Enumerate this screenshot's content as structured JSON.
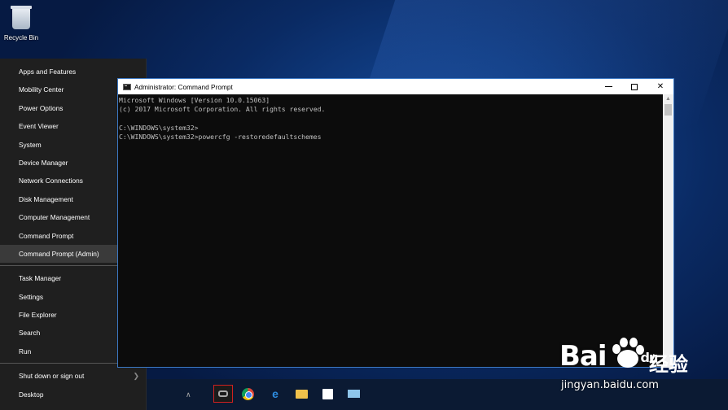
{
  "desktop": {
    "recycle_bin_label": "Recycle Bin"
  },
  "winx_menu": {
    "items": [
      {
        "label": "Apps and Features"
      },
      {
        "label": "Mobility Center"
      },
      {
        "label": "Power Options"
      },
      {
        "label": "Event Viewer"
      },
      {
        "label": "System"
      },
      {
        "label": "Device Manager"
      },
      {
        "label": "Network Connections"
      },
      {
        "label": "Disk Management"
      },
      {
        "label": "Computer Management"
      },
      {
        "label": "Command Prompt"
      },
      {
        "label": "Command Prompt (Admin)",
        "selected": true
      },
      {
        "label": "Task Manager"
      },
      {
        "label": "Settings"
      },
      {
        "label": "File Explorer"
      },
      {
        "label": "Search"
      },
      {
        "label": "Run"
      },
      {
        "label": "Shut down or sign out"
      },
      {
        "label": "Desktop"
      }
    ]
  },
  "console_window": {
    "title": "Administrator: Command Prompt",
    "lines": [
      "Microsoft Windows [Version 10.0.15063]",
      "(c) 2017 Microsoft Corporation. All rights reserved.",
      "",
      "C:\\WINDOWS\\system32>",
      "C:\\WINDOWS\\system32>powercfg -restoredefaultschemes"
    ]
  },
  "taskbar": {
    "icons": [
      "teamviewer-icon",
      "chrome-icon",
      "edge-icon",
      "file-explorer-icon",
      "store-icon",
      "mail-icon"
    ]
  },
  "watermark": {
    "brand": "Bai",
    "brand2": "du",
    "cn": "经验",
    "url": "jingyan.baidu.com"
  },
  "colors": {
    "menu_bg": "#1f1f1f",
    "menu_selected": "#3a3a3a",
    "console_bg": "#0c0c0c",
    "console_text": "#c0c0c0",
    "window_border": "#3b78c4"
  }
}
